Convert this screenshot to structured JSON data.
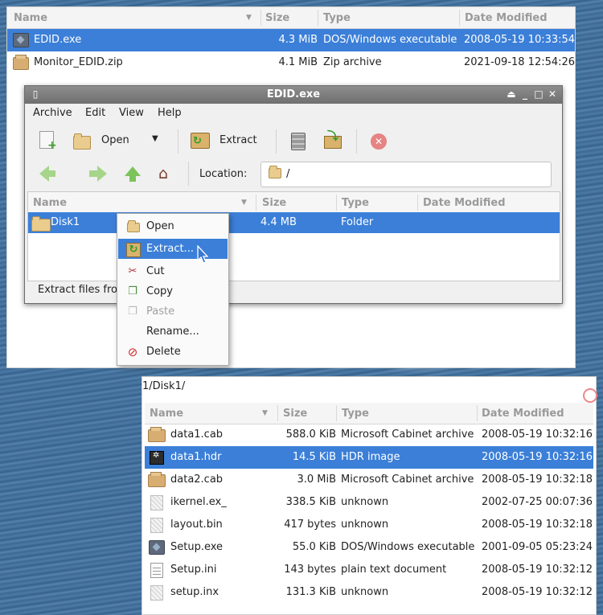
{
  "back_pane": {
    "columns": {
      "name": "Name",
      "size": "Size",
      "type": "Type",
      "date": "Date Modified"
    },
    "rows": [
      {
        "icon": "exe-icon",
        "name": "EDID.exe",
        "size": "4.3 MiB",
        "type": "DOS/Windows executable",
        "date": "2008-05-19 10:33:54",
        "selected": true
      },
      {
        "icon": "zip-icon",
        "name": "Monitor_EDID.zip",
        "size": "4.1 MiB",
        "type": "Zip archive",
        "date": "2021-09-18 12:54:26",
        "selected": false
      }
    ]
  },
  "window": {
    "title": "EDID.exe",
    "menu": [
      "Archive",
      "Edit",
      "View",
      "Help"
    ],
    "toolbar": {
      "open_label": "Open",
      "extract_label": "Extract"
    },
    "location_label": "Location:",
    "location_value": "/",
    "columns": {
      "name": "Name",
      "size": "Size",
      "type": "Type",
      "date": "Date Modified"
    },
    "rows": [
      {
        "name": "Disk1",
        "size": "4.4 MB",
        "type": "Folder",
        "date": ""
      }
    ],
    "status": "Extract files fro"
  },
  "context_menu": {
    "items": [
      {
        "label": "Open",
        "icon": "folder-icon",
        "state": "normal"
      },
      {
        "label": "Extract...",
        "icon": "extract-icon",
        "state": "active"
      },
      {
        "label": "Cut",
        "icon": "scissors-icon",
        "state": "normal"
      },
      {
        "label": "Copy",
        "icon": "copy-icon",
        "state": "normal"
      },
      {
        "label": "Paste",
        "icon": "paste-icon",
        "state": "disabled"
      },
      {
        "label": "Rename...",
        "icon": "",
        "state": "normal"
      },
      {
        "label": "Delete",
        "icon": "delete-icon",
        "state": "normal"
      }
    ]
  },
  "bottom_pane": {
    "path": "1/Disk1/",
    "columns": {
      "name": "Name",
      "size": "Size",
      "type": "Type",
      "date": "Date Modified"
    },
    "rows": [
      {
        "icon": "cab-icon",
        "name": "data1.cab",
        "size": "588.0 KiB",
        "type": "Microsoft Cabinet archive",
        "date": "2008-05-19 10:32:16"
      },
      {
        "icon": "hdr-icon",
        "name": "data1.hdr",
        "size": "14.5 KiB",
        "type": "HDR image",
        "date": "2008-05-19 10:32:16"
      },
      {
        "icon": "cab-icon",
        "name": "data2.cab",
        "size": "3.0 MiB",
        "type": "Microsoft Cabinet archive",
        "date": "2008-05-19 10:32:18"
      },
      {
        "icon": "unknown-icon",
        "name": "ikernel.ex_",
        "size": "338.5 KiB",
        "type": "unknown",
        "date": "2002-07-25 00:07:36"
      },
      {
        "icon": "unknown-icon",
        "name": "layout.bin",
        "size": "417 bytes",
        "type": "unknown",
        "date": "2008-05-19 10:32:18"
      },
      {
        "icon": "exe-icon",
        "name": "Setup.exe",
        "size": "55.0 KiB",
        "type": "DOS/Windows executable",
        "date": "2001-09-05 05:23:24"
      },
      {
        "icon": "text-icon",
        "name": "Setup.ini",
        "size": "143 bytes",
        "type": "plain text document",
        "date": "2008-05-19 10:32:12"
      },
      {
        "icon": "unknown-icon",
        "name": "setup.inx",
        "size": "131.3 KiB",
        "type": "unknown",
        "date": "2008-05-19 10:32:12"
      }
    ]
  },
  "colors": {
    "selection": "#3b7fd8",
    "titlebar": "#7b7b7b",
    "desktop": "#3f6d98"
  }
}
